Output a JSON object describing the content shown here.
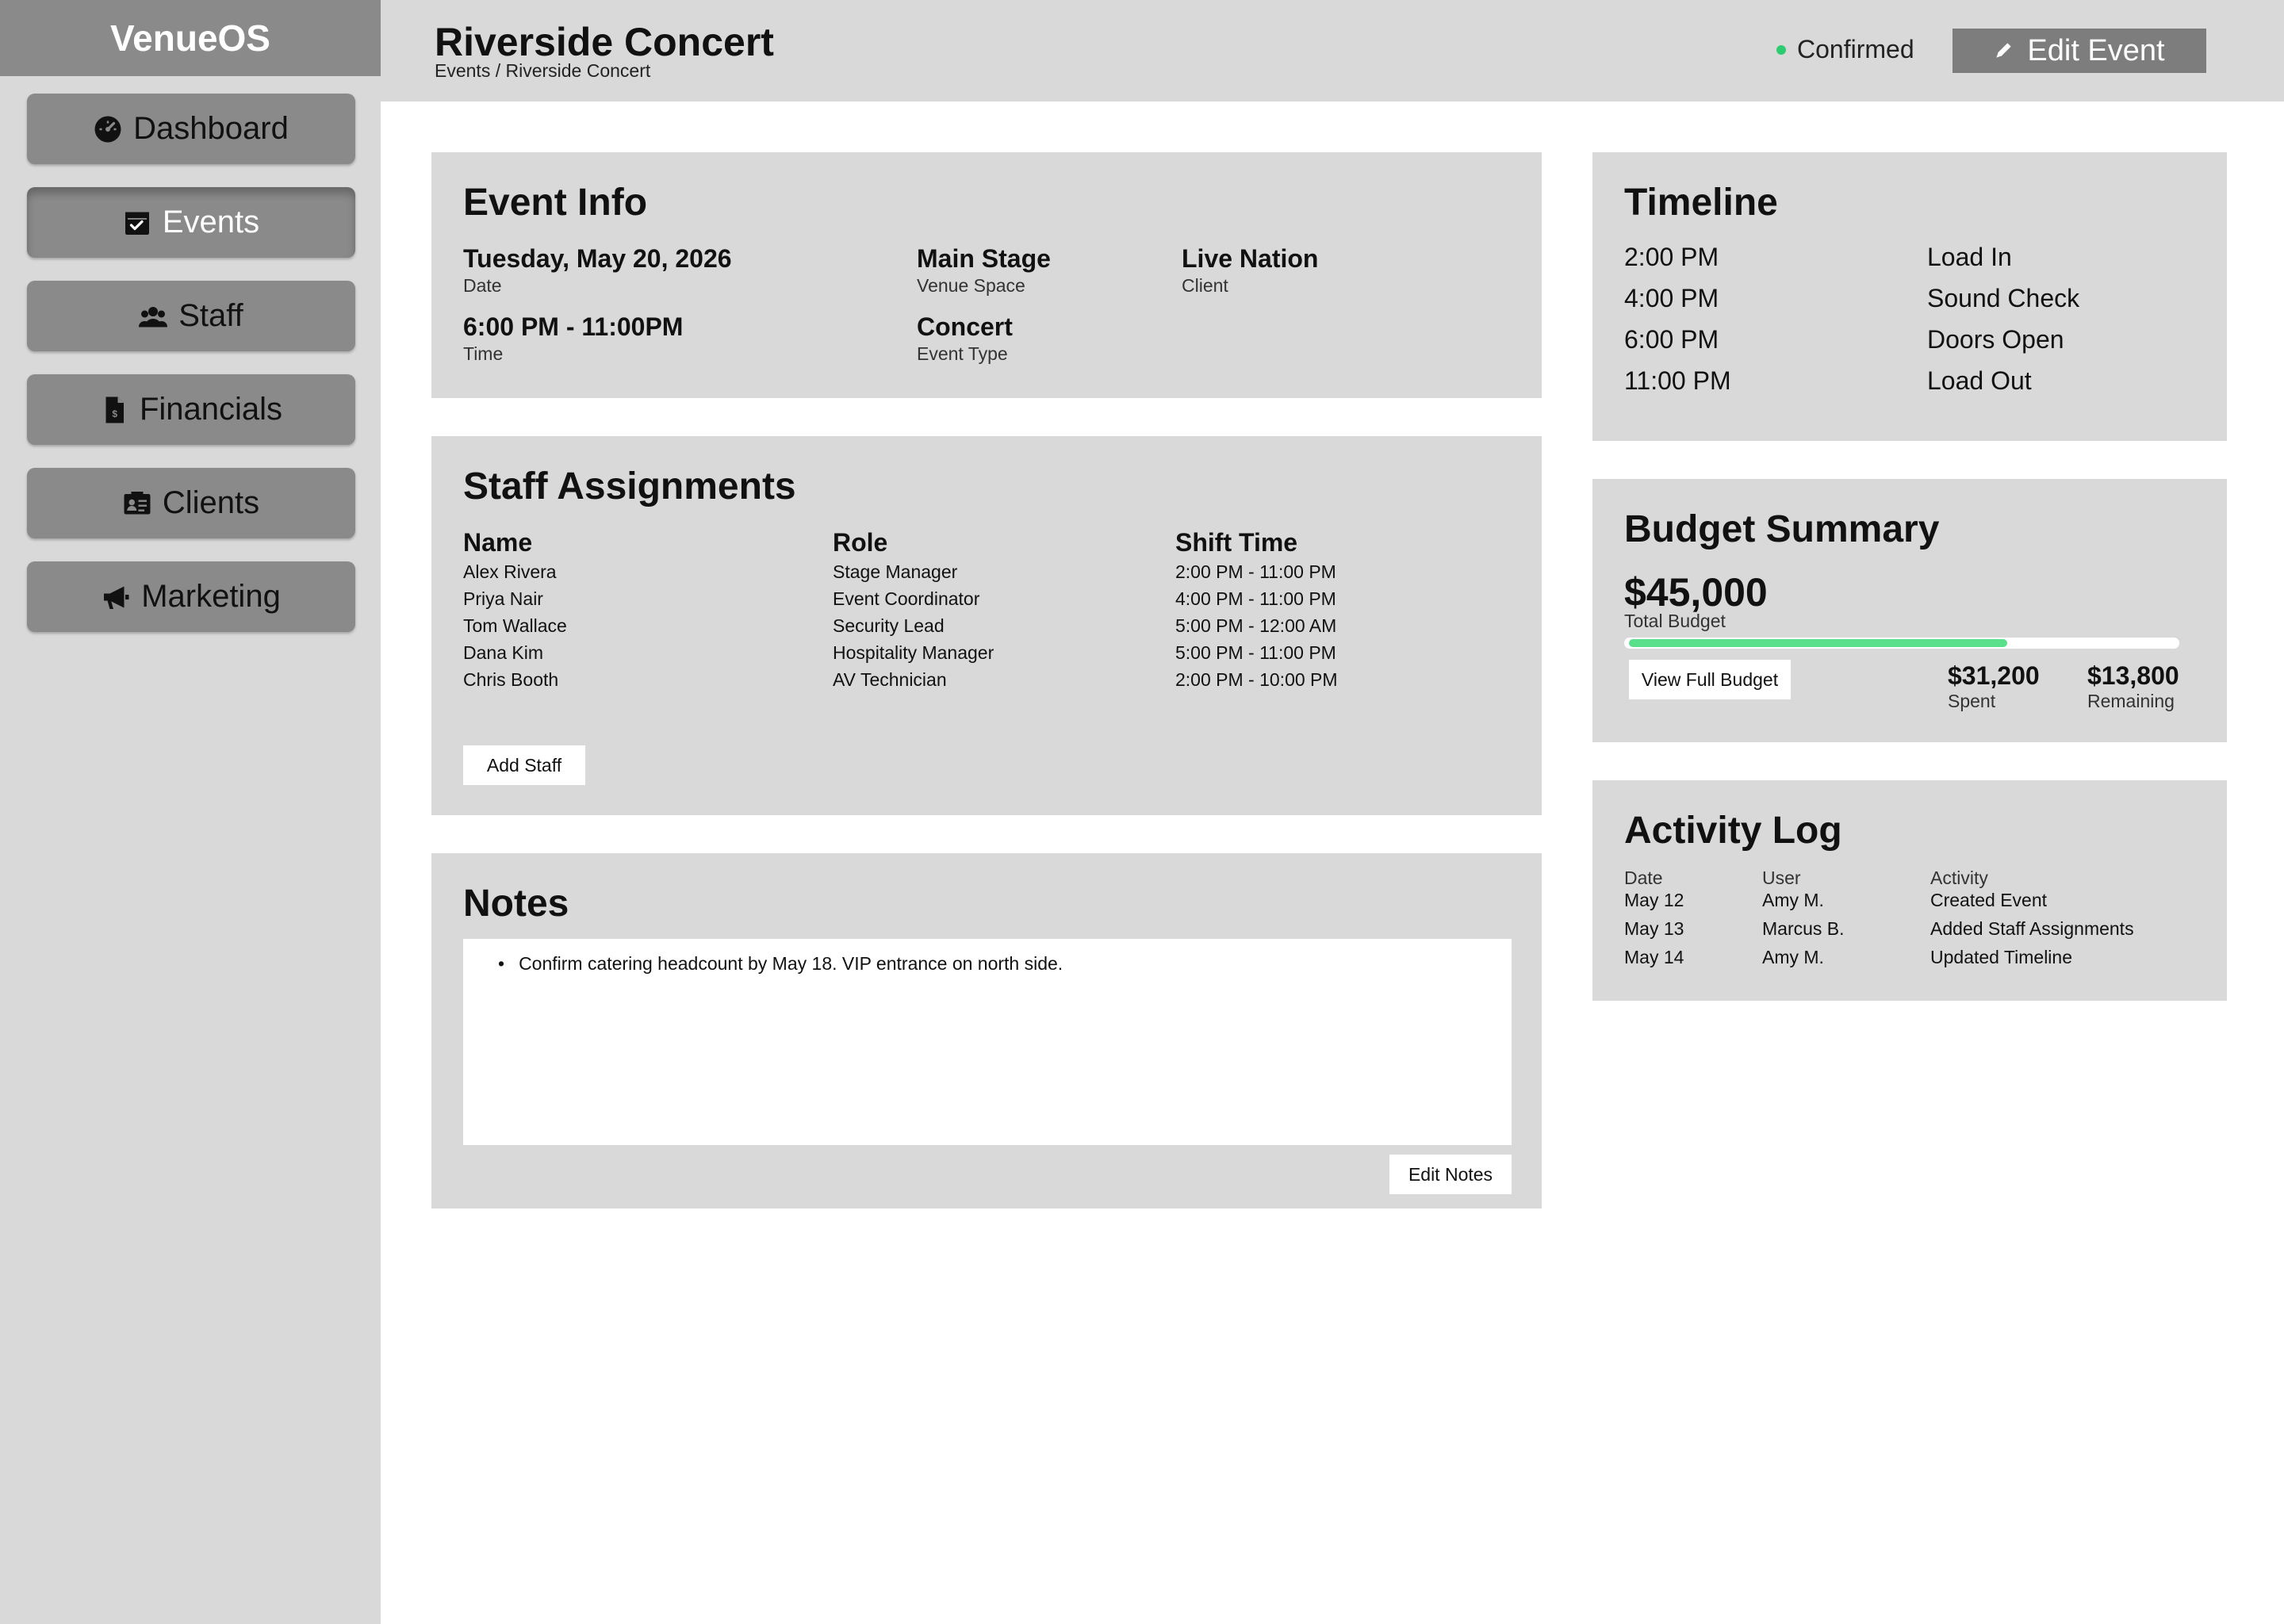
{
  "app": {
    "name": "VenueOS"
  },
  "sidebar": {
    "items": [
      {
        "label": "Dashboard",
        "icon": "dashboard-icon"
      },
      {
        "label": "Events",
        "icon": "calendar-icon",
        "active": true
      },
      {
        "label": "Staff",
        "icon": "users-icon"
      },
      {
        "label": "Financials",
        "icon": "invoice-icon"
      },
      {
        "label": "Clients",
        "icon": "contact-card-icon"
      },
      {
        "label": "Marketing",
        "icon": "megaphone-icon"
      }
    ]
  },
  "header": {
    "title": "Riverside Concert",
    "breadcrumb": "Events / Riverside Concert",
    "status": "Confirmed",
    "status_color": "#2ecc71",
    "edit_label": "Edit Event"
  },
  "event_info": {
    "title": "Event Info",
    "fields": [
      {
        "value": "Tuesday, May 20, 2026",
        "label": "Date"
      },
      {
        "value": "Main Stage",
        "label": "Venue Space"
      },
      {
        "value": "Live Nation",
        "label": "Client"
      },
      {
        "value": "6:00 PM - 11:00PM",
        "label": "Time"
      },
      {
        "value": "Concert",
        "label": "Event Type"
      }
    ]
  },
  "staff": {
    "title": "Staff Assignments",
    "columns": [
      "Name",
      "Role",
      "Shift Time"
    ],
    "rows": [
      [
        "Alex Rivera",
        "Stage Manager",
        "2:00 PM - 11:00 PM"
      ],
      [
        "Priya Nair",
        "Event Coordinator",
        "4:00 PM - 11:00 PM"
      ],
      [
        "Tom Wallace",
        "Security Lead",
        "5:00 PM - 12:00 AM"
      ],
      [
        "Dana Kim",
        "Hospitality Manager",
        "5:00 PM - 11:00 PM"
      ],
      [
        "Chris Booth",
        "AV Technician",
        "2:00 PM - 10:00 PM"
      ]
    ],
    "add_label": "Add Staff"
  },
  "notes": {
    "title": "Notes",
    "items": [
      "Confirm catering headcount by May 18. VIP entrance on north side."
    ],
    "edit_label": "Edit Notes"
  },
  "timeline": {
    "title": "Timeline",
    "items": [
      {
        "time": "2:00 PM",
        "label": "Load In"
      },
      {
        "time": "4:00 PM",
        "label": "Sound Check"
      },
      {
        "time": "6:00 PM",
        "label": "Doors Open"
      },
      {
        "time": "11:00 PM",
        "label": "Load Out"
      }
    ]
  },
  "budget": {
    "title": "Budget Summary",
    "total": "$45,000",
    "total_label": "Total Budget",
    "spent": "$31,200",
    "spent_label": "Spent",
    "remaining": "$13,800",
    "remaining_label": "Remaining",
    "spent_fraction": 0.693,
    "bar_color": "#5ae08a",
    "view_label": "View Full Budget"
  },
  "activity": {
    "title": "Activity Log",
    "columns": [
      "Date",
      "User",
      "Activity"
    ],
    "rows": [
      [
        "May 12",
        "Amy M.",
        "Created Event"
      ],
      [
        "May 13",
        "Marcus B.",
        "Added Staff Assignments"
      ],
      [
        "May 14",
        "Amy M.",
        "Updated Timeline"
      ]
    ]
  }
}
